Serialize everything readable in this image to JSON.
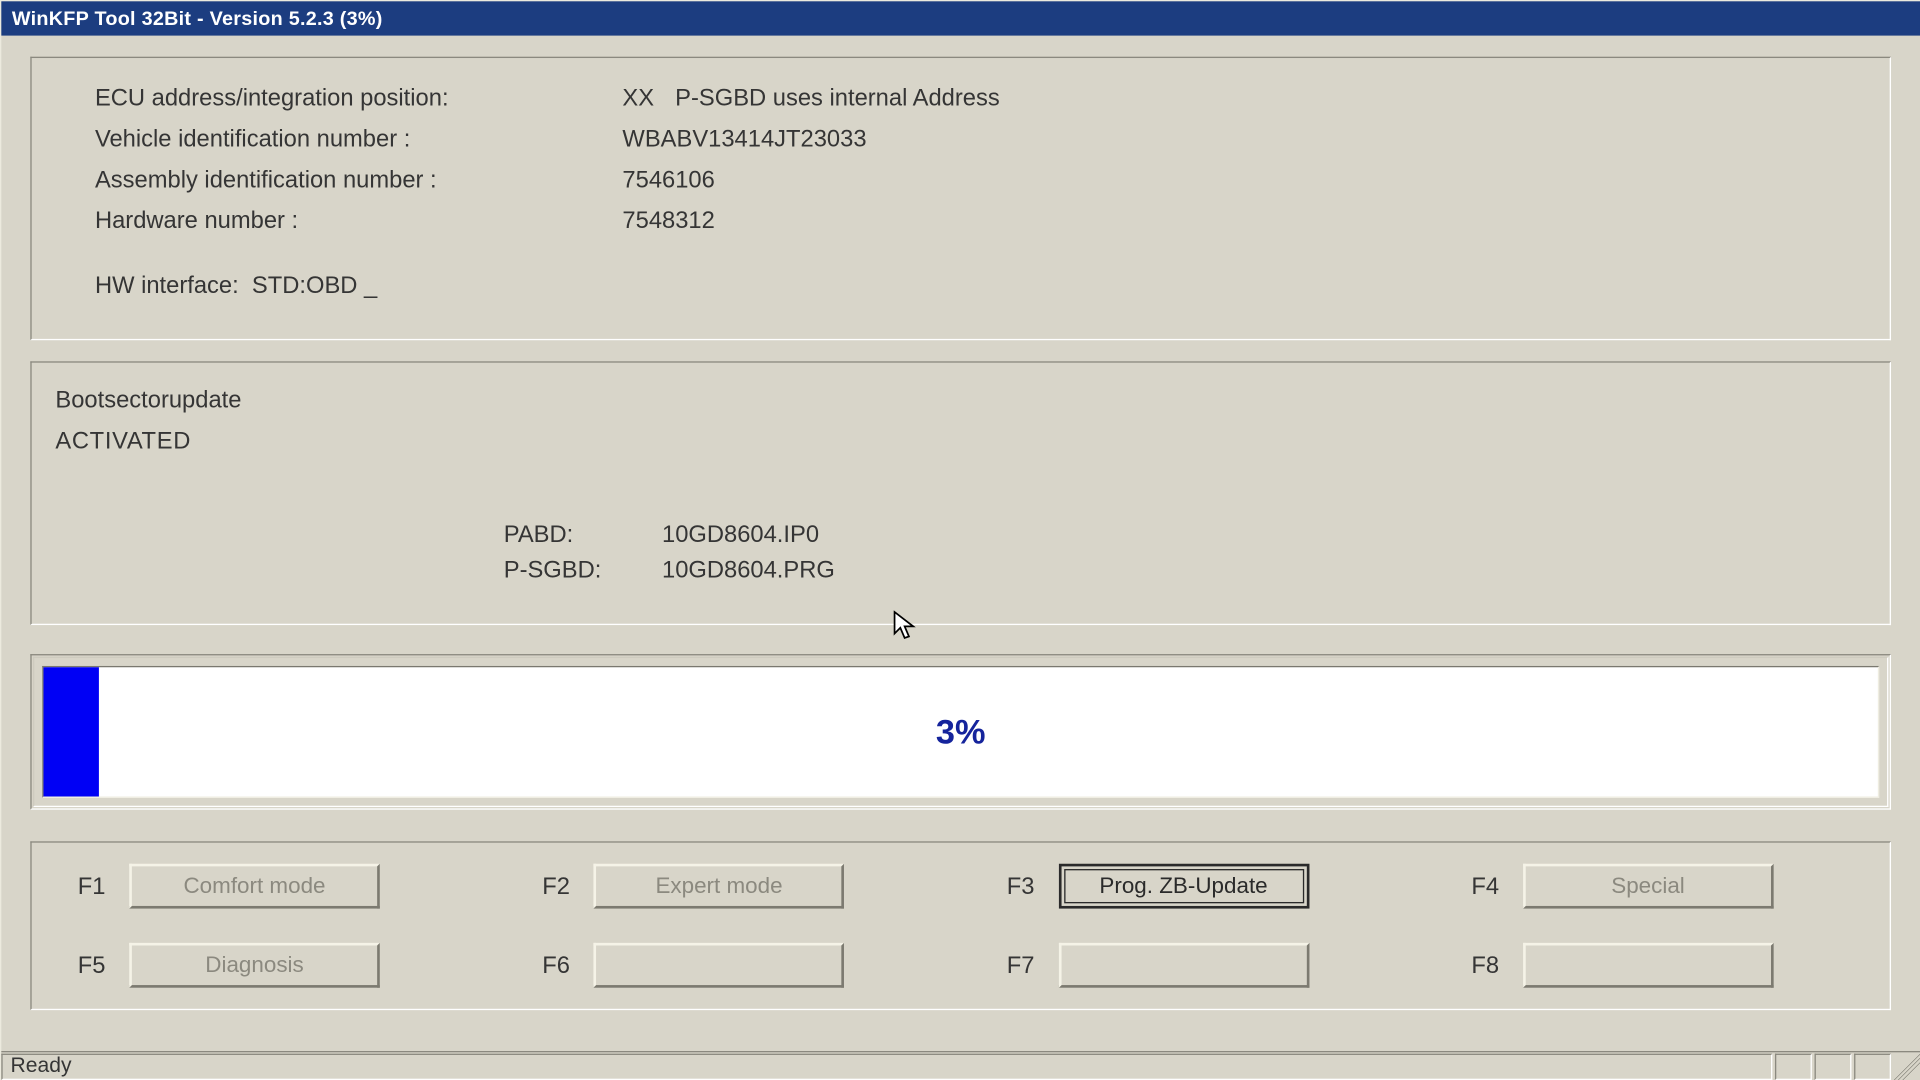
{
  "window": {
    "title": "WinKFP Tool 32Bit - Version 5.2.3 (3%)"
  },
  "info": {
    "ecu_label": "ECU address/integration position:",
    "ecu_prefix": "XX",
    "ecu_value": "P-SGBD uses internal Address",
    "vin_label": "Vehicle identification number :",
    "vin_value": "WBABV13414JT23033",
    "assembly_label": "Assembly identification number :",
    "assembly_value": "7546106",
    "hardware_label": "Hardware number :",
    "hardware_value": "7548312",
    "hwiface_label": "HW interface:",
    "hwiface_value": "STD:OBD _"
  },
  "status": {
    "line1": "Bootsectorupdate",
    "line2": "ACTIVATED",
    "pabd_label": "PABD:",
    "pabd_value": "10GD8604.IP0",
    "psgbd_label": "P-SGBD:",
    "psgbd_value": "10GD8604.PRG"
  },
  "progress": {
    "percent": 3,
    "label": "3%"
  },
  "fkeys": {
    "f1": {
      "key": "F1",
      "label": "Comfort mode"
    },
    "f2": {
      "key": "F2",
      "label": "Expert mode"
    },
    "f3": {
      "key": "F3",
      "label": "Prog. ZB-Update"
    },
    "f4": {
      "key": "F4",
      "label": "Special"
    },
    "f5": {
      "key": "F5",
      "label": "Diagnosis"
    },
    "f6": {
      "key": "F6",
      "label": ""
    },
    "f7": {
      "key": "F7",
      "label": ""
    },
    "f8": {
      "key": "F8",
      "label": ""
    }
  },
  "statusbar": {
    "text": "Ready"
  }
}
